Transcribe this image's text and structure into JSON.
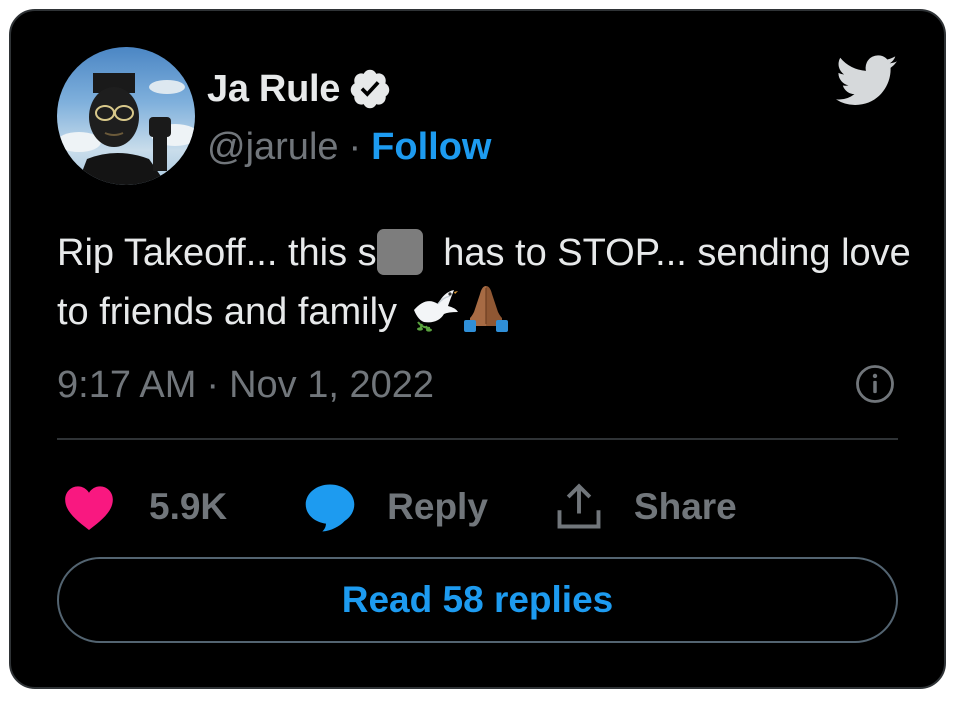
{
  "author": {
    "name": "Ja Rule",
    "handle": "@jarule",
    "separator": "·",
    "follow_label": "Follow",
    "verified": true
  },
  "tweet": {
    "text_part1": "Rip Takeoff... this s",
    "text_part2": " has to STOP... sending love to friends and family ",
    "emoji": [
      "dove",
      "folded-hands"
    ],
    "time": "9:17 AM",
    "date_separator": "·",
    "date": "Nov 1, 2022"
  },
  "actions": {
    "likes": "5.9K",
    "reply_label": "Reply",
    "share_label": "Share"
  },
  "read_replies_label": "Read 58 replies",
  "colors": {
    "background": "#000000",
    "text": "#e7e9ea",
    "secondary": "#71767b",
    "accent": "#1d9bf0",
    "like": "#f91880",
    "border": "#2f3336"
  },
  "icons": [
    "verified-badge-icon",
    "twitter-bird-icon",
    "info-icon",
    "heart-icon",
    "reply-bubble-icon",
    "share-icon"
  ]
}
